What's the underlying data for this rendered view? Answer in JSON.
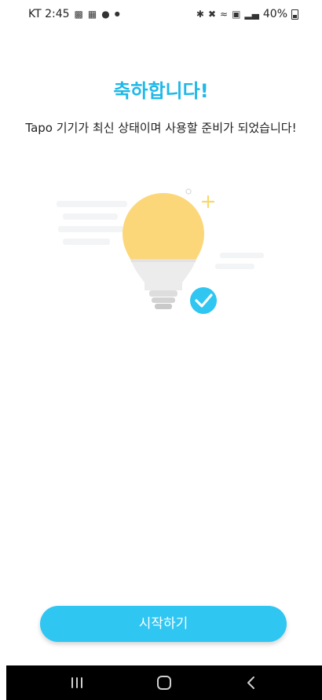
{
  "status_bar": {
    "carrier_time": "KT 2:45",
    "notification_icons": [
      "video-icon",
      "image-icon",
      "chat-icon",
      "dot-icon"
    ],
    "system_icons": [
      "bluetooth-icon",
      "mute-icon",
      "wifi-icon",
      "volte-icon",
      "signal-icon"
    ],
    "battery_text": "40%"
  },
  "title": "축하합니다!",
  "subtitle": "Tapo 기기가 최신 상태이며 사용할 준비가 되었습니다!",
  "illustration": {
    "icons": [
      "lightbulb-icon",
      "check-badge-icon",
      "sparkle-icon"
    ]
  },
  "start_button_label": "시작하기",
  "nav_bar": {
    "buttons": [
      "recents-icon",
      "home-icon",
      "back-icon"
    ]
  },
  "colors": {
    "accent": "#2fc6f2",
    "title": "#1fb8e8",
    "bulb_glow": "#fcd77a",
    "bulb_base": "#ececec"
  }
}
